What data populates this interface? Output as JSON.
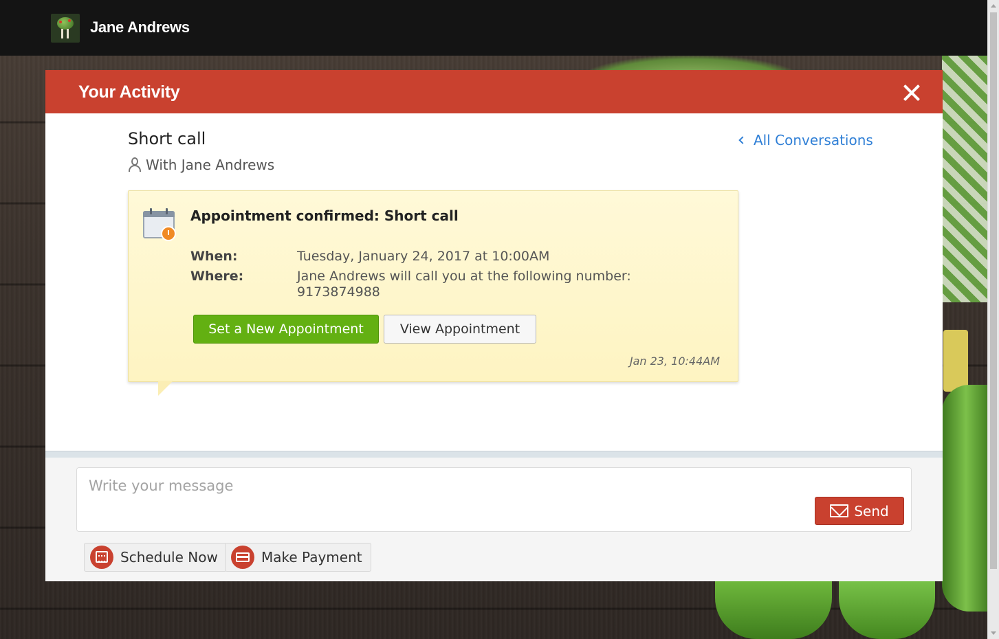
{
  "header": {
    "brand_name": "Jane Andrews",
    "logo_icon": "tree-fork-knife-logo"
  },
  "modal": {
    "title": "Your Activity",
    "close_icon": "close-icon"
  },
  "conversation": {
    "title": "Short call",
    "with_text": "With Jane Andrews",
    "all_conversations_label": "All Conversations"
  },
  "appointment_card": {
    "heading": "Appointment confirmed: Short call",
    "when_label": "When:",
    "when_value": "Tuesday, January 24, 2017 at 10:00AM",
    "where_label": "Where:",
    "where_value_line1": "Jane Andrews will call you at the following number:",
    "where_value_line2": "9173874988",
    "set_new_label": "Set a New Appointment",
    "view_label": "View Appointment",
    "timestamp": "Jan 23, 10:44AM"
  },
  "composer": {
    "placeholder": "Write your message",
    "send_label": "Send"
  },
  "actions": {
    "schedule_label": "Schedule Now",
    "payment_label": "Make Payment"
  },
  "colors": {
    "accent": "#c9412f",
    "green": "#63b012",
    "link": "#2f7fd6"
  }
}
